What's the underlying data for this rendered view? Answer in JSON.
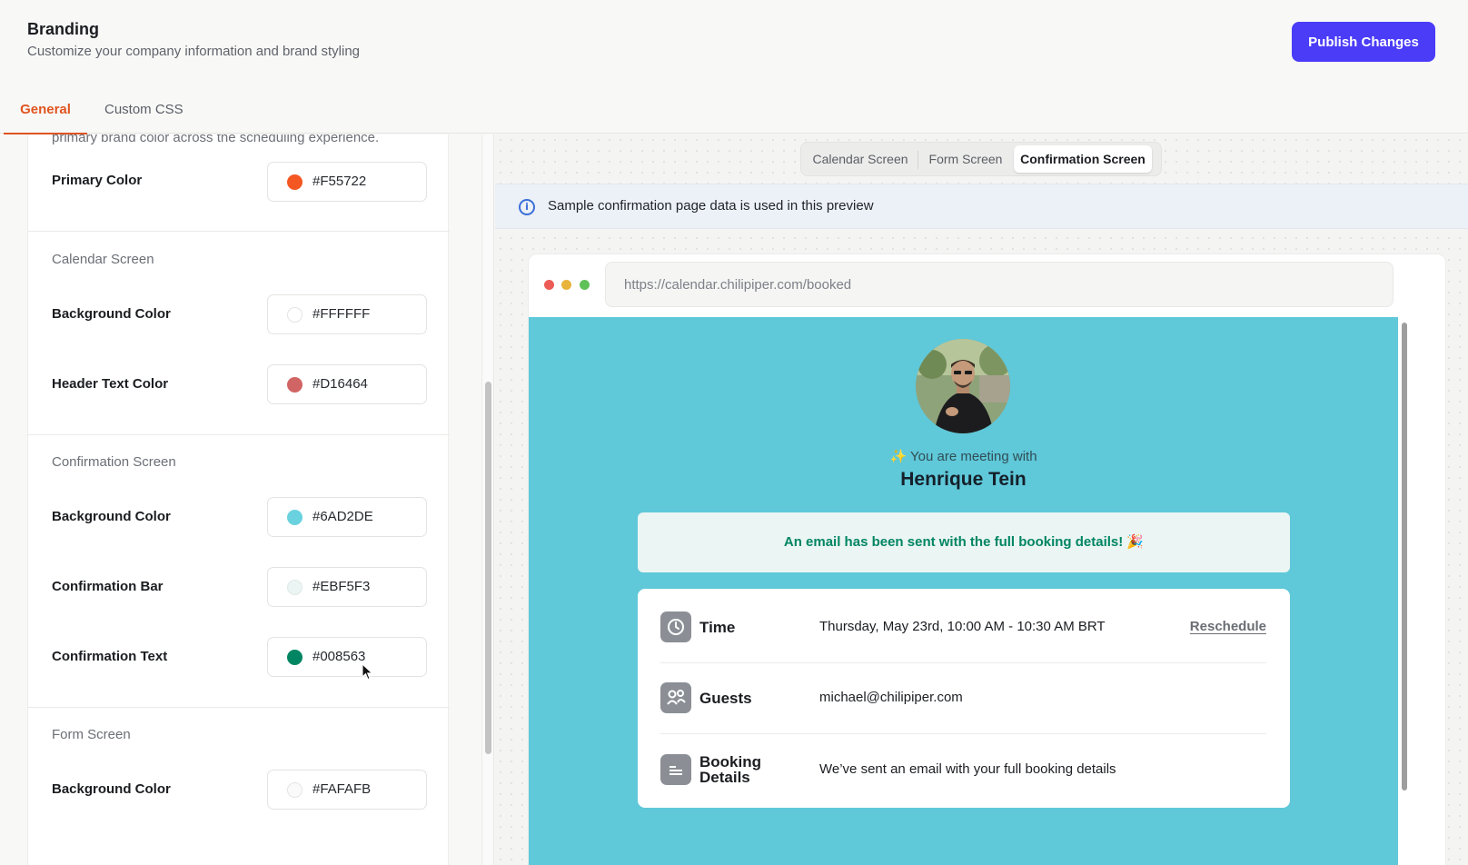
{
  "header": {
    "title": "Branding",
    "subtitle": "Customize your company information and brand styling",
    "publish_label": "Publish Changes"
  },
  "tabs": [
    {
      "label": "General",
      "active": true
    },
    {
      "label": "Custom CSS",
      "active": false
    }
  ],
  "settings": {
    "intro_text": "primary brand color across the scheduling experience.",
    "primary": {
      "label": "Primary Color",
      "value": "#F55722"
    },
    "calendar": {
      "title": "Calendar Screen",
      "background": {
        "label": "Background Color",
        "value": "#FFFFFF"
      },
      "header_text": {
        "label": "Header Text Color",
        "value": "#D16464"
      }
    },
    "confirmation": {
      "title": "Confirmation Screen",
      "background": {
        "label": "Background Color",
        "value": "#6AD2DE"
      },
      "bar": {
        "label": "Confirmation Bar",
        "value": "#EBF5F3"
      },
      "text": {
        "label": "Confirmation Text",
        "value": "#008563"
      }
    },
    "form": {
      "title": "Form Screen",
      "background": {
        "label": "Background Color",
        "value": "#FAFAFB"
      }
    }
  },
  "preview": {
    "screens": [
      {
        "label": "Calendar Screen",
        "active": false
      },
      {
        "label": "Form Screen",
        "active": false
      },
      {
        "label": "Confirmation Screen",
        "active": true
      }
    ],
    "info_text": "Sample confirmation page data is used in this preview",
    "url": "https://calendar.chilipiper.com/booked",
    "meeting_with": "✨ You are meeting with",
    "host_name": "Henrique Tein",
    "confirmation_message": "An email has been sent with the full booking details! 🎉",
    "details": {
      "time_label": "Time",
      "time_value": "Thursday, May 23rd, 10:00 AM - 10:30 AM BRT",
      "reschedule_label": "Reschedule",
      "guests_label": "Guests",
      "guests_value": "michael@chilipiper.com",
      "booking_label_1": "Booking",
      "booking_label_2": "Details",
      "booking_value": "We’ve sent an email with your full booking details"
    }
  },
  "colors": {
    "accent": "#E0541F",
    "publish": "#4A3CF7",
    "confirm_bg": "#5FC8D9",
    "confirm_text": "#008563"
  },
  "icons": [
    "info-icon",
    "clock-icon",
    "guests-icon",
    "details-icon",
    "mouse-cursor-icon"
  ]
}
